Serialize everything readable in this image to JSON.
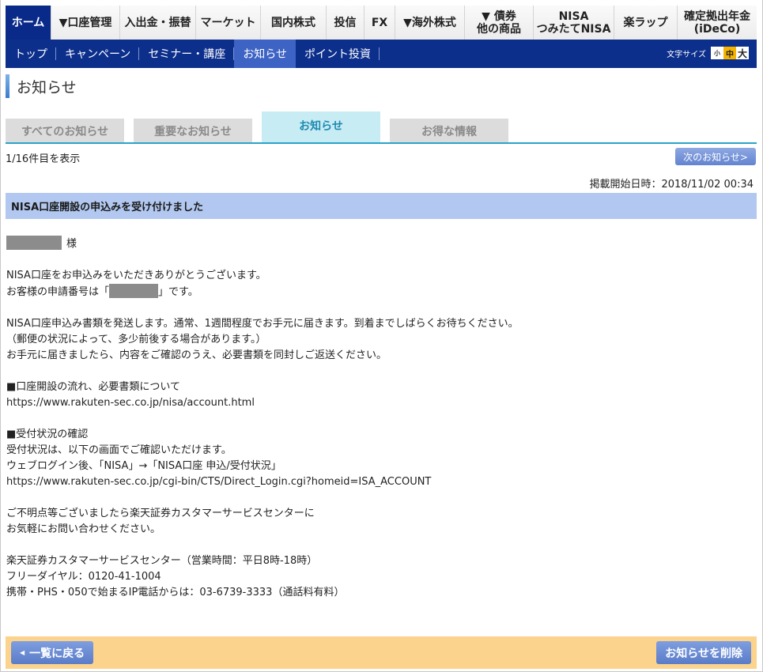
{
  "top_nav": [
    {
      "label": "ホーム",
      "active": true
    },
    {
      "label": "▼口座管理"
    },
    {
      "label": "入出金・振替"
    },
    {
      "label": "マーケット"
    },
    {
      "label": "国内株式"
    },
    {
      "label": "投信"
    },
    {
      "label": "FX"
    },
    {
      "label": "▼海外株式"
    },
    {
      "label": "▼ 債券\n他の商品"
    },
    {
      "label": "NISA\nつみたてNISA"
    },
    {
      "label": "楽ラップ"
    },
    {
      "label": "確定拠出年金\n(iDeCo)"
    }
  ],
  "sub_nav": [
    "トップ",
    "キャンペーン",
    "セミナー・講座",
    "お知らせ",
    "ポイント投資"
  ],
  "font_size": {
    "label": "文字サイズ",
    "small": "小",
    "medium": "中",
    "large": "大",
    "selected": "中"
  },
  "page_title": "お知らせ",
  "tabs": [
    "すべてのお知らせ",
    "重要なお知らせ",
    "お知らせ",
    "お得な情報"
  ],
  "active_tab": "お知らせ",
  "count_text": "1/16件目を表示",
  "next_button": "次のお知らせ>",
  "published": "掲載開始日時：2018/11/02 00:34",
  "subject": "NISA口座開設の申込みを受け付けました",
  "body": {
    "honorific": "様",
    "l1": "NISA口座をお申込みをいただきありがとうございます。",
    "l2_pre": "お客様の申請番号は「",
    "l2_post": "」です。",
    "l3": "NISA口座申込み書類を発送します。通常、1週間程度でお手元に届きます。到着までしばらくお待ちください。",
    "l4": "（郵便の状況によって、多少前後する場合があります。）",
    "l5": "お手元に届きましたら、内容をご確認のうえ、必要書類を同封しご返送ください。",
    "l6": "■口座開設の流れ、必要書類について",
    "l7": "https://www.rakuten-sec.co.jp/nisa/account.html",
    "l8": "■受付状況の確認",
    "l9": "受付状況は、以下の画面でご確認いただけます。",
    "l10": "ウェブログイン後、「NISA」→「NISA口座 申込/受付状況」",
    "l11": "https://www.rakuten-sec.co.jp/cgi-bin/CTS/Direct_Login.cgi?homeid=ISA_ACCOUNT",
    "l12": "ご不明点等ございましたら楽天証券カスタマーサービスセンターに",
    "l13": "お気軽にお問い合わせください。",
    "l14": "楽天証券カスタマーサービスセンター（営業時間：平日8時-18時）",
    "l15": "フリーダイヤル：0120-41-1004",
    "l16": "携帯・PHS・050で始まるIP電話からは：03-6739-3333（通話料有料）"
  },
  "back_button": "一覧に戻る",
  "delete_button": "お知らせを削除"
}
